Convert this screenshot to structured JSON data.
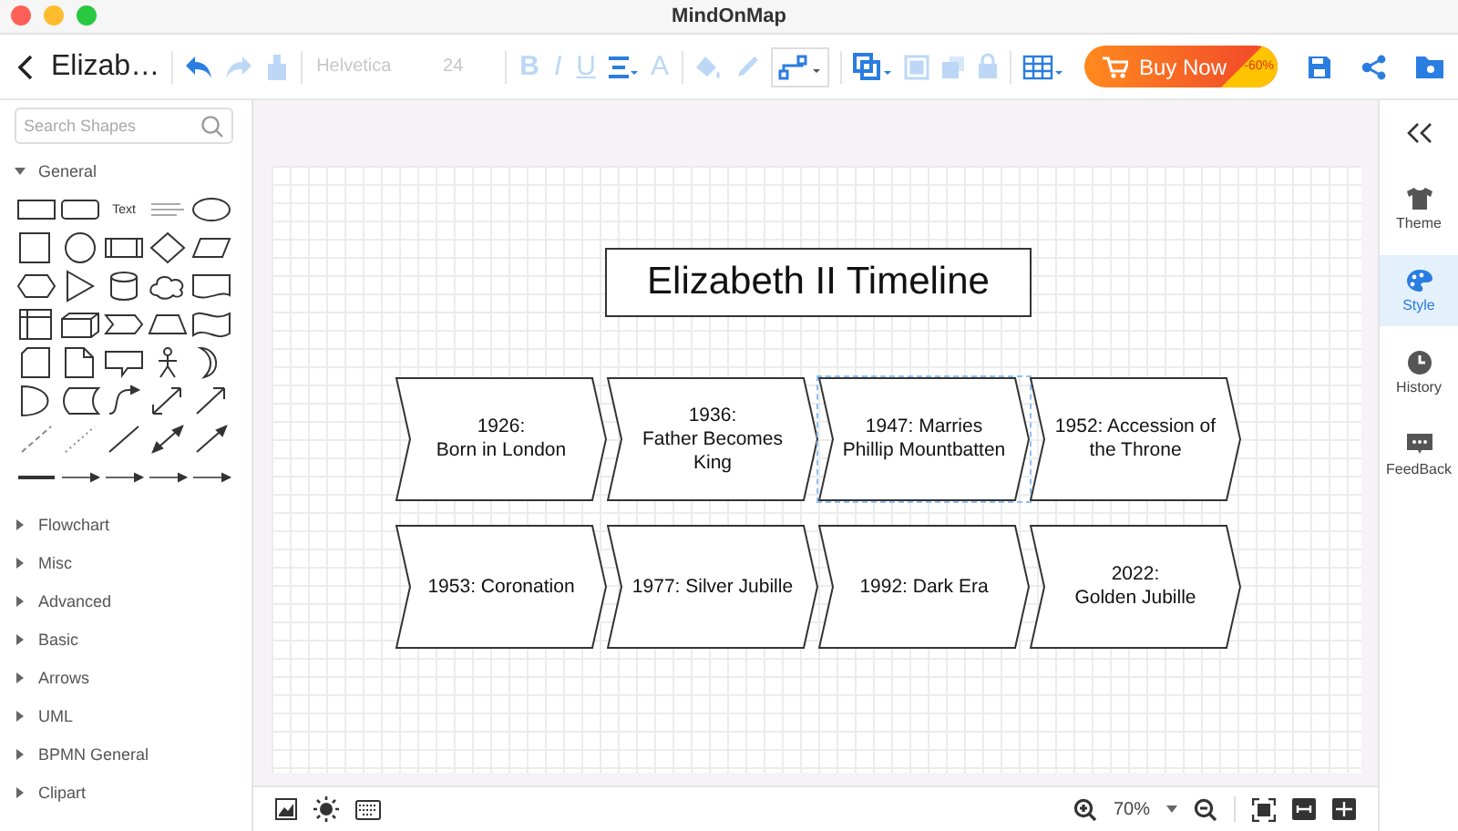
{
  "window": {
    "title": "MindOnMap"
  },
  "toolbar": {
    "document_title": "Elizab…",
    "undo": {
      "disabled": false
    },
    "redo": {
      "disabled": true
    },
    "format_painter": {
      "disabled": true
    },
    "font": {
      "value": "Helvetica",
      "disabled": true
    },
    "font_size": {
      "value": "24",
      "disabled": true
    },
    "text_styles": [
      {
        "label": "B",
        "disabled": true
      },
      {
        "label": "I",
        "disabled": true
      },
      {
        "label": "U",
        "disabled": true
      }
    ],
    "align": {
      "disabled": false
    },
    "font_color": {
      "label": "A",
      "disabled": true
    },
    "fill": {
      "disabled": true
    },
    "line_color": {
      "disabled": true
    },
    "connector": {
      "disabled": false
    },
    "arrange": {
      "disabled": false
    },
    "to_front": {
      "disabled": true
    },
    "to_back": {
      "disabled": true
    },
    "lock": {
      "disabled": true
    },
    "table": {
      "disabled": false
    },
    "buy_button": {
      "label": "Buy Now",
      "badge": "-60%"
    }
  },
  "sidebar": {
    "search": {
      "placeholder": "Search Shapes"
    },
    "palette_text": "Text",
    "categories": [
      {
        "label": "General",
        "expanded": true
      },
      {
        "label": "Flowchart",
        "expanded": false
      },
      {
        "label": "Misc",
        "expanded": false
      },
      {
        "label": "Advanced",
        "expanded": false
      },
      {
        "label": "Basic",
        "expanded": false
      },
      {
        "label": "Arrows",
        "expanded": false
      },
      {
        "label": "UML",
        "expanded": false
      },
      {
        "label": "BPMN General",
        "expanded": false
      },
      {
        "label": "Clipart",
        "expanded": false
      }
    ]
  },
  "canvas": {
    "title": "Elizabeth II Timeline",
    "steps": [
      {
        "text": "1926:\nBorn in London",
        "selected": false
      },
      {
        "text": "1936:\nFather Becomes\nKing",
        "selected": false
      },
      {
        "text": "1947: Marries\nPhillip Mountbatten",
        "selected": true
      },
      {
        "text": "1952: Accession of\nthe Throne",
        "selected": false
      },
      {
        "text": "1953: Coronation",
        "selected": false
      },
      {
        "text": "1977: Silver Jubille",
        "selected": false
      },
      {
        "text": "1992: Dark Era",
        "selected": false
      },
      {
        "text": "2022:\nGolden Jubille",
        "selected": false
      }
    ]
  },
  "right_panel": [
    {
      "label": "Theme",
      "selected": false
    },
    {
      "label": "Style",
      "selected": true
    },
    {
      "label": "History",
      "selected": false
    },
    {
      "label": "FeedBack",
      "selected": false
    }
  ],
  "status_bar": {
    "zoom": "70%"
  }
}
